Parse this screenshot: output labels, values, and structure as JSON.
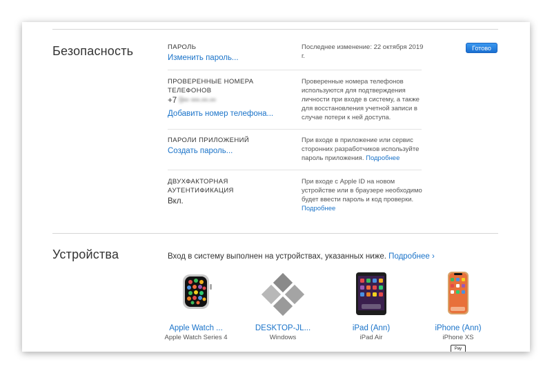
{
  "security": {
    "title": "Безопасность",
    "done_button": "Готово",
    "password": {
      "label": "ПАРОЛЬ",
      "action": "Изменить пароль...",
      "description": "Последнее изменение: 22 октября 2019 г."
    },
    "phones": {
      "label": "ПРОВЕРЕННЫЕ НОМЕРА ТЕЛЕФОНОВ",
      "number_prefix": "+7",
      "number_hidden": "9•• •••-••-••",
      "action": "Добавить номер телефона...",
      "description": "Проверенные номера телефонов используются для подтверждения личности при входе в систему, а также для восстановления учетной записи в случае потери к ней доступа."
    },
    "app_passwords": {
      "label": "ПАРОЛИ ПРИЛОЖЕНИЙ",
      "action": "Создать пароль...",
      "description": "При входе в приложение или сервис сторонних разработчиков используйте пароль приложения.",
      "more": "Подробнее"
    },
    "two_factor": {
      "label": "ДВУХФАКТОРНАЯ АУТЕНТИФИКАЦИЯ",
      "value": "Вкл.",
      "description": "При входе с Apple ID на новом устройстве или в браузере необходимо будет ввести пароль и код проверки.",
      "more": "Подробнее"
    }
  },
  "devices": {
    "title": "Устройства",
    "intro": "Вход в систему выполнен на устройствах, указанных ниже.",
    "more": "Подробнее ›",
    "items": [
      {
        "name": "Apple Watch ...",
        "model": "Apple Watch Series 4",
        "icon": "apple-watch-icon"
      },
      {
        "name": "DESKTOP-JL...",
        "model": "Windows",
        "icon": "windows-logo-icon"
      },
      {
        "name": "iPad (Ann)",
        "model": "iPad Air",
        "icon": "ipad-icon"
      },
      {
        "name": "iPhone (Ann)",
        "model": "iPhone XS",
        "icon": "iphone-icon"
      }
    ],
    "apple_pay_badge": "Pay"
  }
}
